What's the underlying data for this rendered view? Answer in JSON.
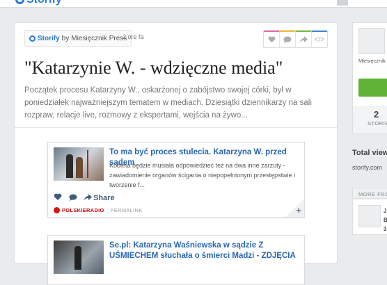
{
  "topbar": {
    "logo": "Storify"
  },
  "story": {
    "attribution": {
      "brand": "Storify",
      "by": "by",
      "author": "Miesięcznik Press"
    },
    "time": "2 ore fa",
    "actions": [
      "like-icon",
      "comment-icon",
      "share-icon",
      "embed-icon"
    ],
    "action_colors": [
      "#e96ba6",
      "#f1c232",
      "#7ac142",
      "#3d8ed9"
    ],
    "title": "\"Katarzynie W. - wdzięczne media\"",
    "description": "Początek procesu Katarzyny W., oskarżonej o zabójstwo swojej córki, był w poniedziałek najważniejszym tematem w mediach. Dziesiątki dziennikarzy na sali rozpraw, relacje live, rozmowy z ekspertami, wejścia na żywo..."
  },
  "items": [
    {
      "title": "To ma być proces stulecia. Katarzyna W. przed sądem",
      "body": "Kobieta będzie musiała odpowiedzieć też na dwa inne zarzuty - zawiadomienie organów ścigania o niepopełnionym przestępstwie i tworzenie f...",
      "share": "Share",
      "source": "POLSKIERADIO",
      "sep": "·",
      "permalink": "PERMALINK",
      "expand": "+"
    },
    {
      "title": "Se.pl: Katarzyna Waśniewska w sądzie Z UŚMIECHEM słuchała o śmierci Madzi - ZDJĘCIA"
    }
  ],
  "sidebar": {
    "user_text": "Miesięcznik media, adv",
    "stat_number": "2",
    "stat_label": "STORIES",
    "total_views": "Total views",
    "total_source": "storify.com",
    "more_from": "MORE FROM",
    "more_line1": "J",
    "more_line2": "B",
    "more_line3": "3"
  }
}
